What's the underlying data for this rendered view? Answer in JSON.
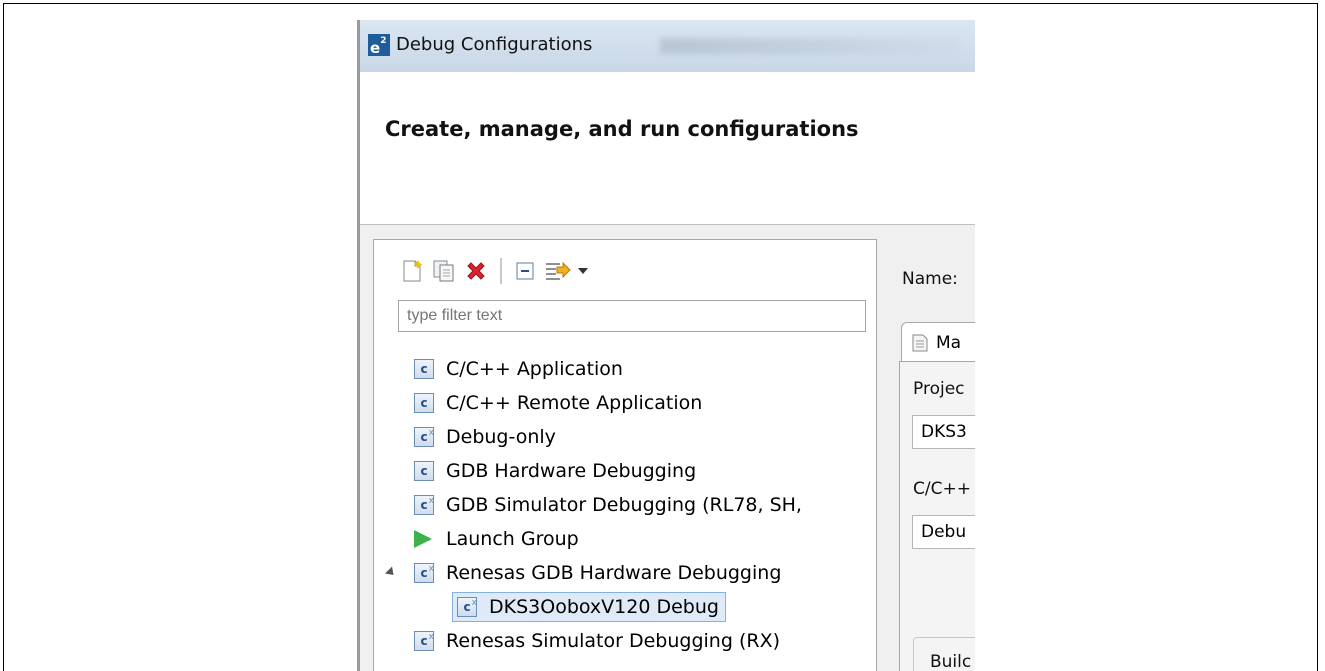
{
  "window": {
    "title": "Debug Configurations",
    "logo_text": "e",
    "logo_sup": "2"
  },
  "header": {
    "heading": "Create, manage, and run configurations"
  },
  "toolbar": {
    "icons": [
      "new-configuration-icon",
      "duplicate-icon",
      "delete-icon",
      "collapse-all-icon",
      "filter-icon",
      "dropdown-arrow-icon"
    ]
  },
  "filter": {
    "placeholder": "type filter text"
  },
  "tree": {
    "items": [
      {
        "label": "C/C++ Application",
        "icon": "c-app-icon"
      },
      {
        "label": "C/C++ Remote Application",
        "icon": "c-app-icon"
      },
      {
        "label": "Debug-only",
        "icon": "c-debug-icon"
      },
      {
        "label": "GDB Hardware Debugging",
        "icon": "c-app-icon"
      },
      {
        "label": "GDB Simulator Debugging (RL78, SH,",
        "icon": "c-debug-icon"
      },
      {
        "label": "Launch Group",
        "icon": "launch-group-icon"
      },
      {
        "label": "Renesas GDB Hardware Debugging",
        "icon": "c-debug-icon",
        "expanded": true
      },
      {
        "label": "DKS3OoboxV120 Debug",
        "icon": "c-debug-icon",
        "selected": true
      },
      {
        "label": "Renesas Simulator Debugging (RX)",
        "icon": "c-debug-icon"
      }
    ]
  },
  "right": {
    "name_label": "Name:",
    "tab_label": "Ma",
    "project_label": "Projec",
    "project_value": "DKS3",
    "app_label": "C/C++",
    "app_value": "Debu",
    "build_label": "Builc"
  }
}
